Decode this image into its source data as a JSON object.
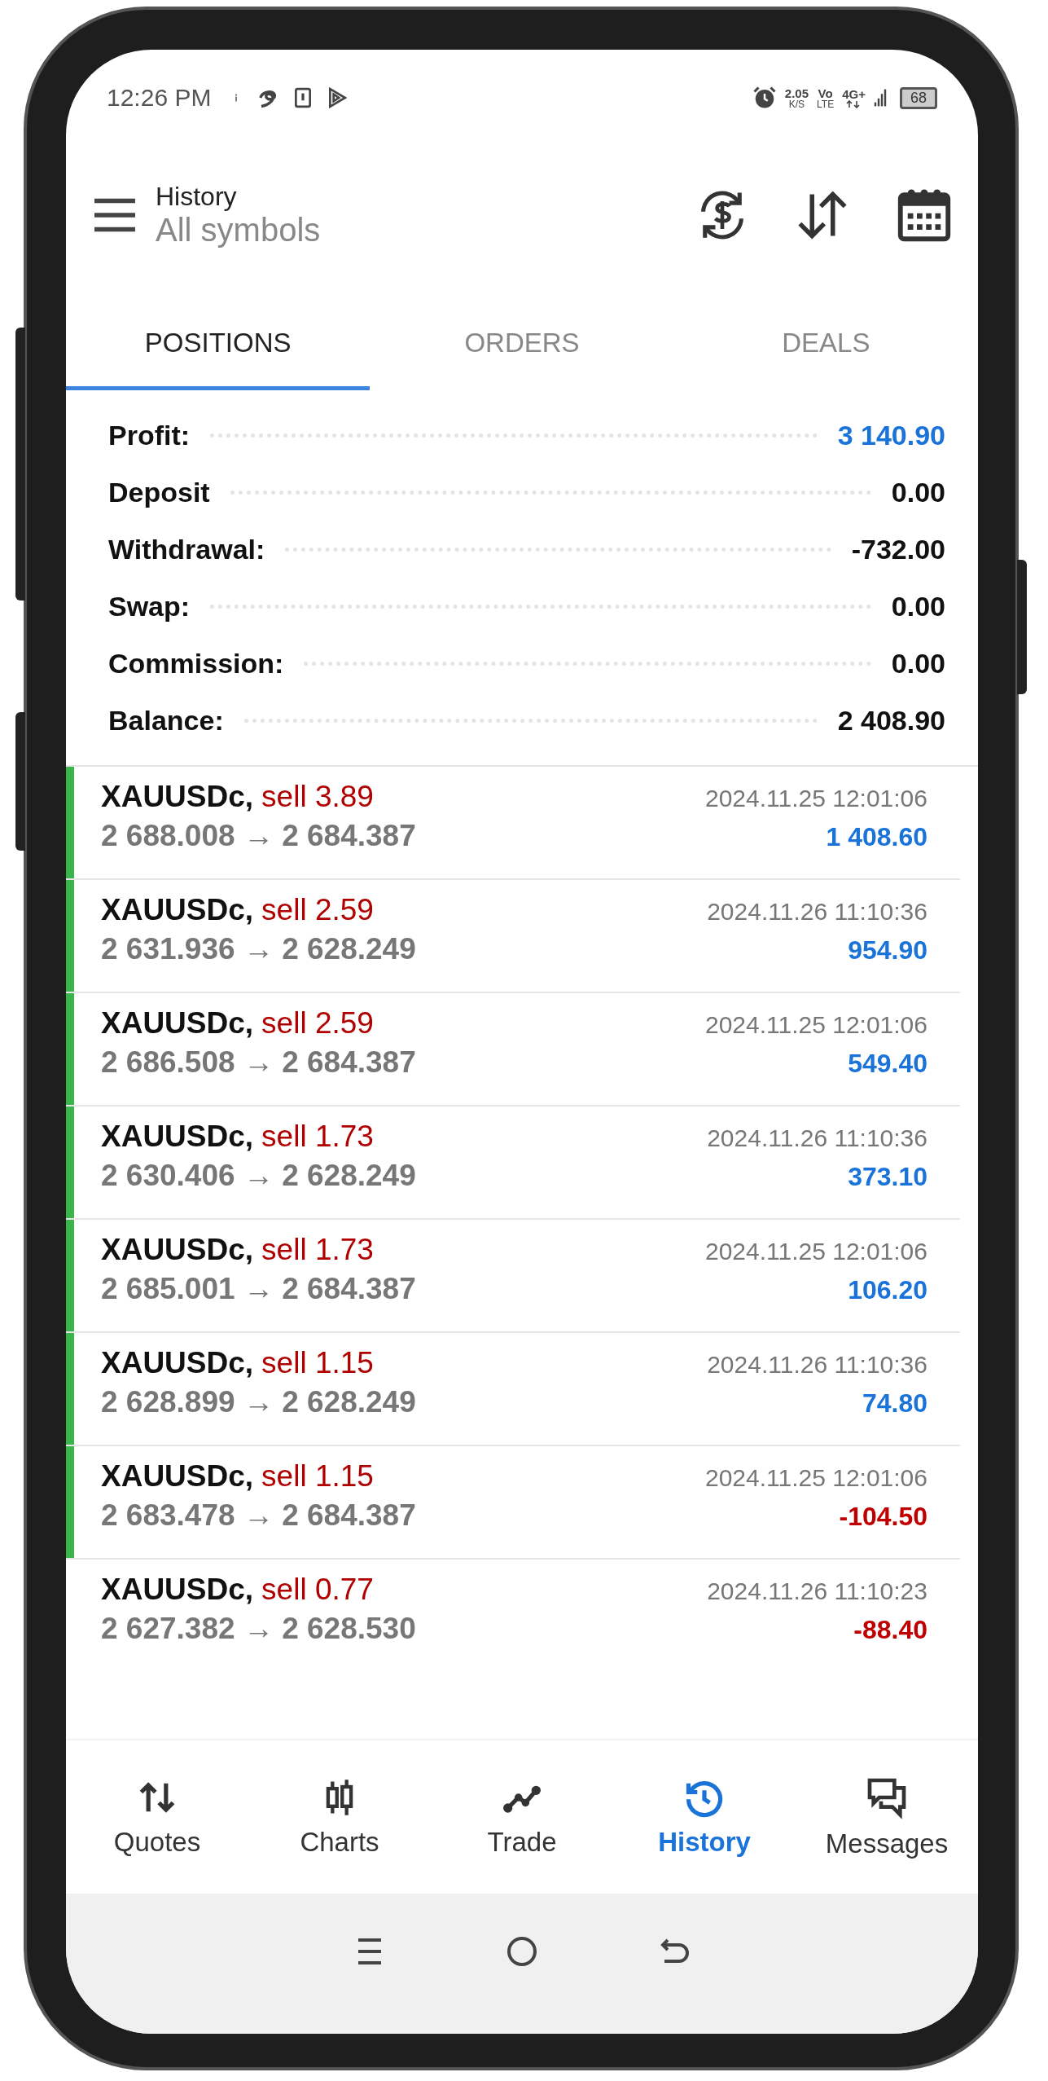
{
  "status_bar": {
    "time": "12:26 PM",
    "speed": "2.05",
    "speed_unit": "K/S",
    "volte_top": "Vo",
    "volte_bottom": "LTE",
    "network": "4G+",
    "battery": "68"
  },
  "header": {
    "title": "History",
    "subtitle": "All symbols"
  },
  "tabs": [
    {
      "label": "POSITIONS",
      "selected": true
    },
    {
      "label": "ORDERS",
      "selected": false
    },
    {
      "label": "DEALS",
      "selected": false
    }
  ],
  "summary": [
    {
      "label": "Profit:",
      "value": "3 140.90",
      "highlight": true
    },
    {
      "label": "Deposit",
      "value": "0.00",
      "highlight": false
    },
    {
      "label": "Withdrawal:",
      "value": "-732.00",
      "highlight": false
    },
    {
      "label": "Swap:",
      "value": "0.00",
      "highlight": false
    },
    {
      "label": "Commission:",
      "value": "0.00",
      "highlight": false
    },
    {
      "label": "Balance:",
      "value": "2 408.90",
      "highlight": false
    }
  ],
  "positions": [
    {
      "symbol": "XAUUSDc,",
      "side": "sell 3.89",
      "prices": "2 688.008 → 2 684.387",
      "time": "2024.11.25 12:01:06",
      "profit": "1 408.60",
      "kind": "gain",
      "marked": true
    },
    {
      "symbol": "XAUUSDc,",
      "side": "sell 2.59",
      "prices": "2 631.936 → 2 628.249",
      "time": "2024.11.26 11:10:36",
      "profit": "954.90",
      "kind": "gain",
      "marked": true
    },
    {
      "symbol": "XAUUSDc,",
      "side": "sell 2.59",
      "prices": "2 686.508 → 2 684.387",
      "time": "2024.11.25 12:01:06",
      "profit": "549.40",
      "kind": "gain",
      "marked": true
    },
    {
      "symbol": "XAUUSDc,",
      "side": "sell 1.73",
      "prices": "2 630.406 → 2 628.249",
      "time": "2024.11.26 11:10:36",
      "profit": "373.10",
      "kind": "gain",
      "marked": true
    },
    {
      "symbol": "XAUUSDc,",
      "side": "sell 1.73",
      "prices": "2 685.001 → 2 684.387",
      "time": "2024.11.25 12:01:06",
      "profit": "106.20",
      "kind": "gain",
      "marked": true
    },
    {
      "symbol": "XAUUSDc,",
      "side": "sell 1.15",
      "prices": "2 628.899 → 2 628.249",
      "time": "2024.11.26 11:10:36",
      "profit": "74.80",
      "kind": "gain",
      "marked": true
    },
    {
      "symbol": "XAUUSDc,",
      "side": "sell 1.15",
      "prices": "2 683.478 → 2 684.387",
      "time": "2024.11.25 12:01:06",
      "profit": "-104.50",
      "kind": "loss",
      "marked": true
    },
    {
      "symbol": "XAUUSDc,",
      "side": "sell 0.77",
      "prices": "2 627.382 → 2 628.530",
      "time": "2024.11.26 11:10:23",
      "profit": "-88.40",
      "kind": "loss",
      "marked": false
    }
  ],
  "bottom_nav": [
    {
      "label": "Quotes",
      "kind": "quotes",
      "selected": false
    },
    {
      "label": "Charts",
      "kind": "charts",
      "selected": false
    },
    {
      "label": "Trade",
      "kind": "trade",
      "selected": false
    },
    {
      "label": "History",
      "kind": "history",
      "selected": true
    },
    {
      "label": "Messages",
      "kind": "messages",
      "selected": false
    }
  ]
}
